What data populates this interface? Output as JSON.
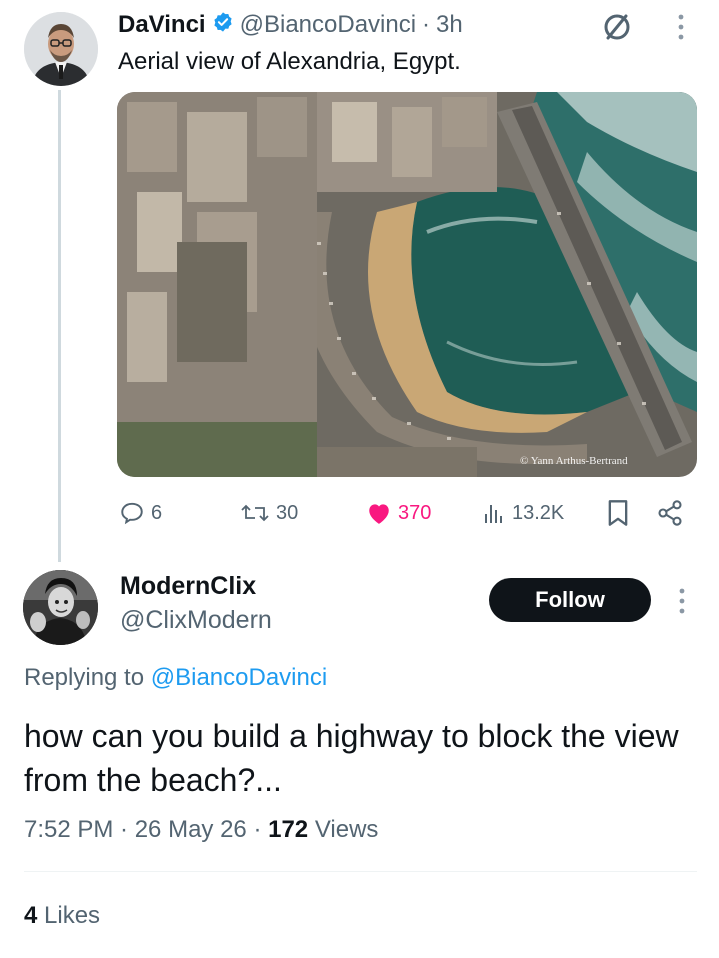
{
  "post": {
    "author_name": "DaVinci",
    "author_handle": "@BiancoDavinci",
    "time": "3h",
    "text": "Aerial view of Alexandria, Egypt.",
    "image_credit": "© Yann Arthus-Bertrand",
    "stats": {
      "replies": "6",
      "reposts": "30",
      "likes": "370",
      "views": "13.2K"
    }
  },
  "reply": {
    "author_name": "ModernClix",
    "author_handle": "@ClixModern",
    "follow_label": "Follow",
    "replying_prefix": "Replying to",
    "replying_mention": "@BiancoDavinci",
    "text": "how can you build a highway to block the view from the beach?...",
    "timestamp": "7:52 PM · 26 May 26 · ",
    "views_count": "172",
    "views_label": " Views",
    "likes_count": "4",
    "likes_label": " Likes"
  },
  "colors": {
    "accent": "#1d9bf0",
    "like_pink": "#f91880",
    "text_primary": "#0f1419",
    "text_secondary": "#536471"
  },
  "icons": [
    "verified-badge-icon",
    "no-sign-icon",
    "more-icon",
    "reply-icon",
    "repost-icon",
    "heart-icon",
    "views-icon",
    "bookmark-icon",
    "share-icon"
  ]
}
